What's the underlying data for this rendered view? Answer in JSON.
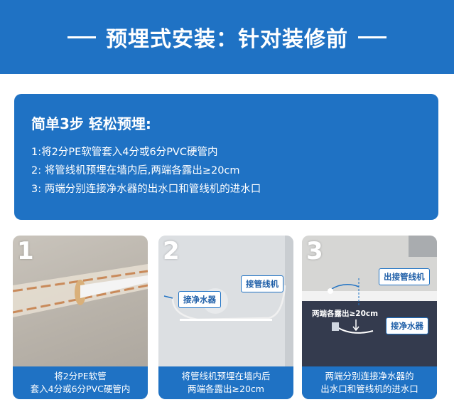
{
  "header": {
    "title": "预埋式安装：针对装修前"
  },
  "steps": {
    "heading": "简单3步 轻松预埋:",
    "items": [
      "1:将2分PE软管套入4分或6分PVC硬管内",
      "2: 将管线机预埋在墙内后,两端各露出≥20cm",
      "3: 两端分别连接净水器的出水口和管线机的进水口"
    ]
  },
  "panels": [
    {
      "number": "1",
      "caption_line1": "将2分PE软管",
      "caption_line2": "套入4分或6分PVC硬管内"
    },
    {
      "number": "2",
      "caption_line1": "将管线机预埋在墙内后",
      "caption_line2": "两端各露出≥20cm",
      "tag_left": "接净水器",
      "tag_right": "接管线机"
    },
    {
      "number": "3",
      "caption_line1": "两端分别连接净水器的",
      "caption_line2": "出水口和管线机的进水口",
      "tag_top": "出接管线机",
      "tag_middle": "两端各露出≥20cm",
      "tag_bottom": "接净水器"
    }
  ],
  "colors": {
    "brand_blue": "#1f72c4"
  }
}
